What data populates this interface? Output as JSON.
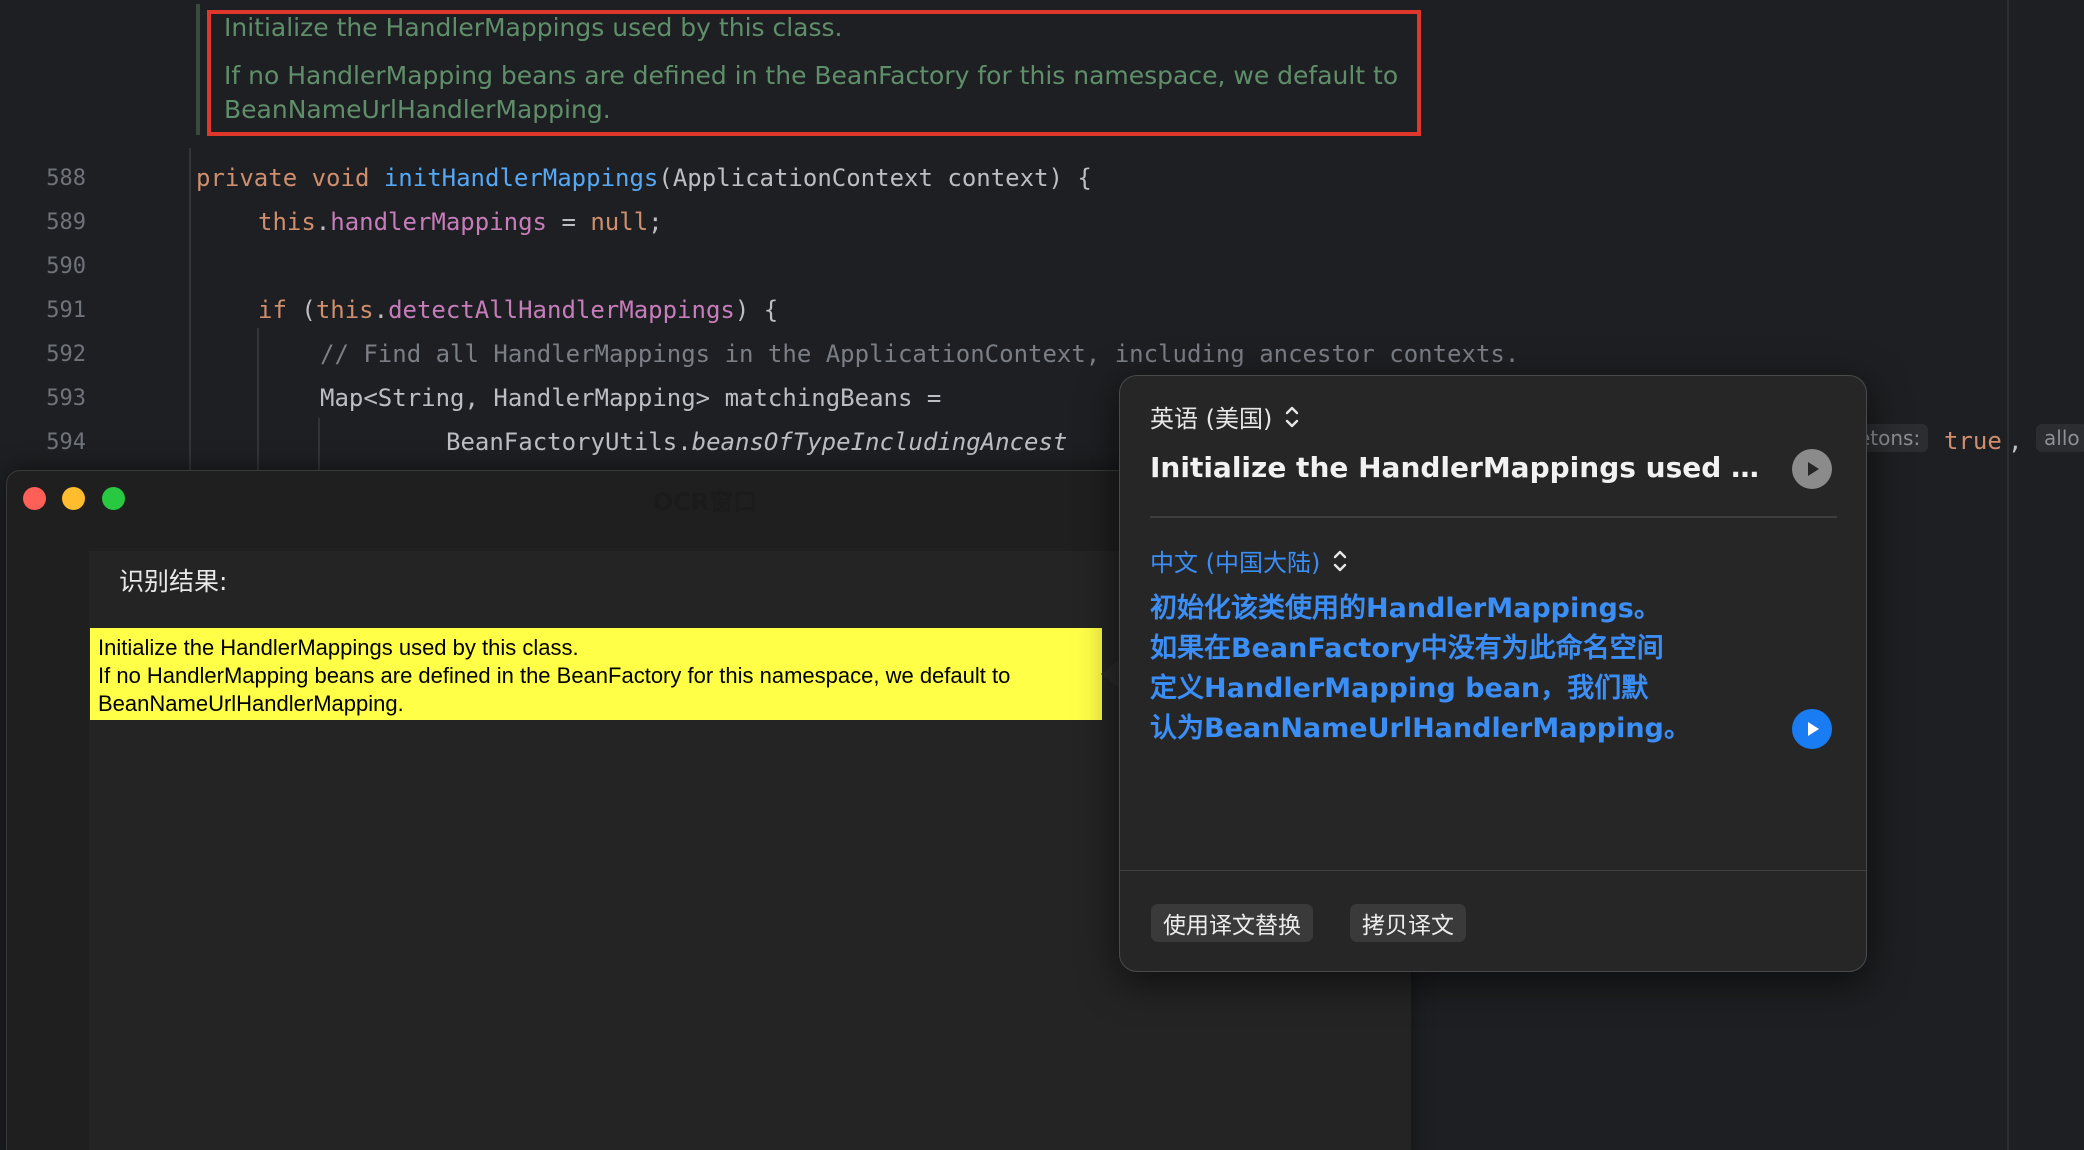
{
  "editor": {
    "doc_comment": {
      "line1": "Initialize the HandlerMappings used by this class.",
      "line2": "If no HandlerMapping beans are defined in the BeanFactory for this namespace, we default to",
      "line3": "BeanNameUrlHandlerMapping."
    },
    "line_numbers": [
      "588",
      "589",
      "590",
      "591",
      "592",
      "593",
      "594"
    ],
    "code": {
      "l588_kw": "private void ",
      "l588_fn": "initHandlerMappings",
      "l588_rest": "(ApplicationContext context) {",
      "l589_kw": "this",
      "l589_dot": ".",
      "l589_field": "handlerMappings",
      "l589_eq": " = ",
      "l589_null": "null",
      "l589_semi": ";",
      "l591_if": "if ",
      "l591_paren": "(",
      "l591_this": "this",
      "l591_dot": ".",
      "l591_field": "detectAllHandlerMappings",
      "l591_rest": ") {",
      "l592_comment": "// Find all HandlerMappings in the ApplicationContext, including ancestor contexts.",
      "l593": "Map<String, HandlerMapping> matchingBeans =",
      "l594_cls": "BeanFactoryUtils.",
      "l594_method": "beansOfTypeIncludingAncest",
      "hint_singletons": "etons:",
      "true_kw": "true",
      "comma": ",",
      "hint_allow": "allo"
    }
  },
  "ocr_window": {
    "title": "OCR窗口",
    "result_label": "识别结果:",
    "result_lines": [
      "Initialize the HandlerMappings used by this class.",
      "If no HandlerMapping beans are defined in the BeanFactory for this namespace, we default to",
      "BeanNameUrlHandlerMapping."
    ]
  },
  "translate_popover": {
    "source_language": "英语 (美国)",
    "source_text": "Initialize the HandlerMappings used by th...",
    "target_language": "中文 (中国大陆)",
    "target_lines": [
      "初始化该类使用的HandlerMappings。",
      "如果在BeanFactory中没有为此命名空间",
      "定义HandlerMapping bean，我们默",
      "认为BeanNameUrlHandlerMapping。"
    ],
    "replace_button": "使用译文替换",
    "copy_button": "拷贝译文"
  },
  "colors": {
    "highlight_box": "#e0372c",
    "ocr_highlight": "#ffff47",
    "accent_blue": "#3a8ef6",
    "window_close": "#fe5f57",
    "window_minimize": "#febc2e",
    "window_zoom": "#28c840"
  },
  "icons": [
    "play-icon",
    "updown-chevron-icon"
  ]
}
